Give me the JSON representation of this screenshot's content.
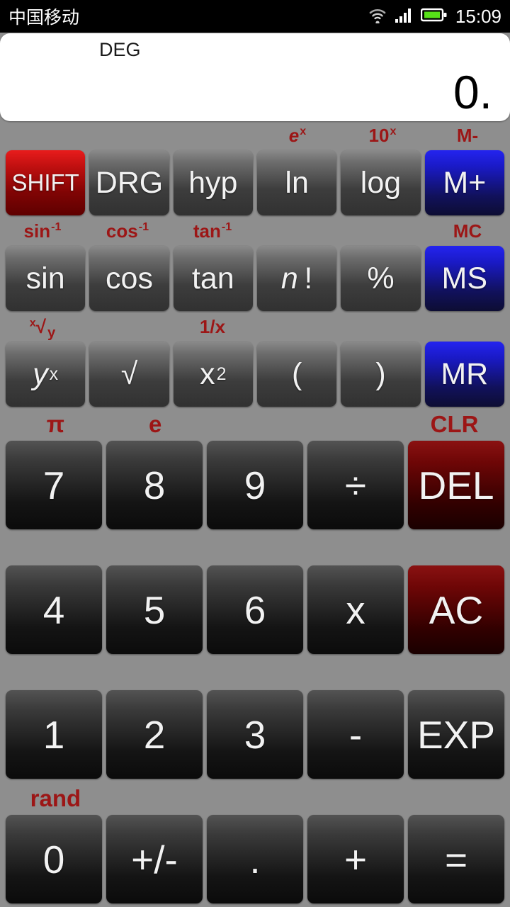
{
  "statusbar": {
    "carrier": "中国移动",
    "time": "15:09",
    "icons": {
      "wifi": "wifi-icon",
      "signal": "signal-bars-icon",
      "battery": "battery-icon"
    },
    "battery_color": "#57e018"
  },
  "display": {
    "mode": "DEG",
    "value": "0."
  },
  "theme": {
    "background": "#8e8e8e",
    "shift_label_color": "#9c1616",
    "gray_key_top": "#8a8a8a",
    "gray_key_bottom": "#313131",
    "dark_key_top": "#535353",
    "dark_key_bottom": "#0b0b0b",
    "red_key_top": "#e81c1c",
    "red_key_bottom": "#5e0000",
    "darkred_key_top": "#8a1212",
    "darkred_key_bottom": "#1a0000",
    "blue_key_top": "#2424ef",
    "blue_key_bottom": "#0d0d33"
  },
  "keypad": {
    "rows": [
      {
        "type": "scientific",
        "shift_labels": [
          "",
          "",
          "",
          "e^x",
          "10^x",
          "M-"
        ],
        "keys": [
          "SHIFT",
          "DRG",
          "hyp",
          "ln",
          "log",
          "M+"
        ]
      },
      {
        "type": "scientific",
        "shift_labels": [
          "sin-1",
          "cos-1",
          "tan-1",
          "",
          "",
          "MC"
        ],
        "keys": [
          "sin",
          "cos",
          "tan",
          "n!",
          "%",
          "MS"
        ]
      },
      {
        "type": "scientific",
        "shift_labels": [
          "x-root-y",
          "",
          "1/x",
          "",
          "",
          ""
        ],
        "keys": [
          "y^x",
          "√",
          "x2",
          "(",
          ")",
          "MR"
        ]
      },
      {
        "type": "numeric",
        "shift_labels": [
          "π",
          "e",
          "",
          "",
          "CLR"
        ],
        "keys": [
          "7",
          "8",
          "9",
          "÷",
          "DEL"
        ]
      },
      {
        "type": "numeric",
        "shift_labels": [
          "",
          "",
          "",
          "",
          ""
        ],
        "keys": [
          "4",
          "5",
          "6",
          "x",
          "AC"
        ]
      },
      {
        "type": "numeric",
        "shift_labels": [
          "",
          "",
          "",
          "",
          ""
        ],
        "keys": [
          "1",
          "2",
          "3",
          "-",
          "EXP"
        ]
      },
      {
        "type": "numeric",
        "shift_labels": [
          "rand",
          "",
          "",
          "",
          ""
        ],
        "keys": [
          "0",
          "+/-",
          ".",
          "+",
          "="
        ]
      }
    ]
  }
}
